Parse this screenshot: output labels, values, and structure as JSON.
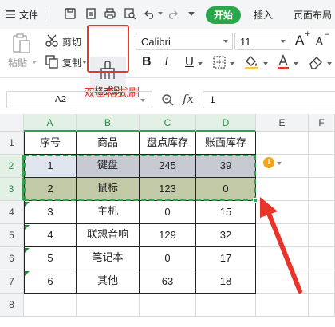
{
  "menubar": {
    "file_label": "文件",
    "tabs": [
      "开始",
      "插入",
      "页面布局"
    ]
  },
  "ribbon": {
    "paste_label": "粘贴",
    "cut_label": "剪切",
    "copy_label": "复制",
    "format_painter_label": "格式刷",
    "font_name": "Calibri",
    "font_size": "11",
    "bold": "B",
    "italic": "I",
    "underline": "U",
    "font_grow": "A",
    "font_shrink": "A"
  },
  "annotation": "双击格式刷",
  "formula_bar": {
    "cell_ref": "A2",
    "fx_label": "fx",
    "value": "1"
  },
  "sheet": {
    "columns": [
      "A",
      "B",
      "C",
      "D",
      "E",
      "F"
    ],
    "rows": [
      "1",
      "2",
      "3",
      "4",
      "5",
      "6",
      "7",
      "8"
    ],
    "headers": [
      "序号",
      "商品",
      "盘点库存",
      "账面库存"
    ],
    "data": [
      [
        "1",
        "键盘",
        "245",
        "39"
      ],
      [
        "2",
        "鼠标",
        "123",
        "0"
      ],
      [
        "3",
        "主机",
        "0",
        "15"
      ],
      [
        "4",
        "联想音响",
        "129",
        "32"
      ],
      [
        "5",
        "笔记本",
        "0",
        "17"
      ],
      [
        "6",
        "其他",
        "63",
        "18"
      ]
    ]
  },
  "colors": {
    "accent": "#2aa74a",
    "highlight": "#e03a2b",
    "row2_fill": "#c5cad3",
    "row3_fill": "#c2c9a7"
  }
}
